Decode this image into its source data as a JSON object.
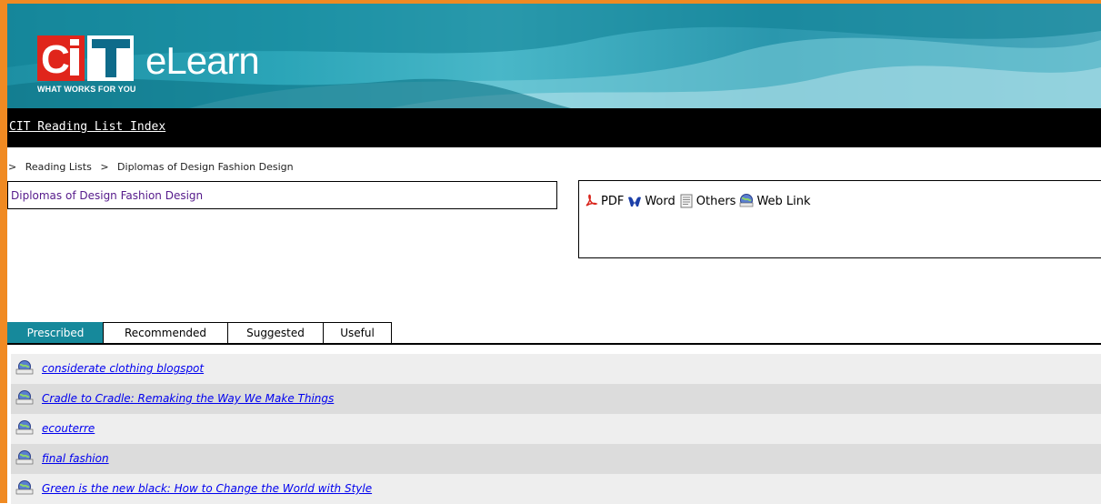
{
  "header": {
    "logo_text": "CIT",
    "logo_tagline": "WHAT WORKS FOR YOU",
    "app_title": "eLearn"
  },
  "nav": {
    "link_label": "CIT Reading List Index"
  },
  "breadcrumb": {
    "separator": ">",
    "items": [
      "Reading Lists",
      "Diplomas of Design Fashion Design"
    ]
  },
  "title_box": {
    "title": "Diplomas of Design Fashion Design"
  },
  "legend": {
    "items": [
      {
        "label": "PDF",
        "icon": "pdf-icon"
      },
      {
        "label": "Word",
        "icon": "word-icon"
      },
      {
        "label": "Others",
        "icon": "document-icon"
      },
      {
        "label": "Web Link",
        "icon": "globe-icon"
      }
    ]
  },
  "tabs": [
    {
      "label": "Prescribed",
      "active": true
    },
    {
      "label": "Recommended",
      "active": false
    },
    {
      "label": "Suggested",
      "active": false
    },
    {
      "label": "Useful",
      "active": false
    }
  ],
  "reading_list": [
    {
      "title": "considerate clothing blogspot",
      "type": "web-link"
    },
    {
      "title": "Cradle to Cradle: Remaking the Way We Make Things",
      "type": "web-link"
    },
    {
      "title": "ecouterre",
      "type": "web-link"
    },
    {
      "title": "final fashion",
      "type": "web-link"
    },
    {
      "title": "Green is the new black: How to Change the World with Style",
      "type": "web-link"
    }
  ],
  "colors": {
    "frame_orange": "#f08a22",
    "banner_teal": "#2ba5b8",
    "logo_red": "#e0251b",
    "active_tab": "#16899b",
    "link_blue": "#0000ee",
    "title_purple": "#551a8b"
  }
}
